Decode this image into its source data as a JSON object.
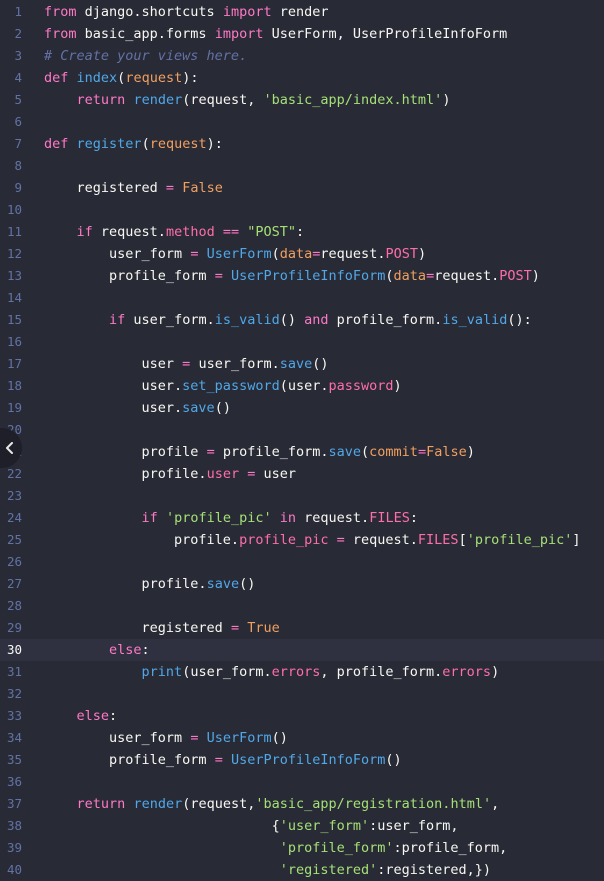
{
  "lines": [
    {
      "n": "1",
      "tokens": [
        [
          "kw",
          "from"
        ],
        [
          "plain",
          " django.shortcuts "
        ],
        [
          "kw",
          "import"
        ],
        [
          "plain",
          " render"
        ]
      ]
    },
    {
      "n": "2",
      "tokens": [
        [
          "kw",
          "from"
        ],
        [
          "plain",
          " basic_app.forms "
        ],
        [
          "kw",
          "import"
        ],
        [
          "plain",
          " UserForm, UserProfileInfoForm"
        ]
      ]
    },
    {
      "n": "3",
      "tokens": [
        [
          "cmt",
          "# Create your views here."
        ]
      ]
    },
    {
      "n": "4",
      "tokens": [
        [
          "kw",
          "def"
        ],
        [
          "plain",
          " "
        ],
        [
          "fn",
          "index"
        ],
        [
          "plain",
          "("
        ],
        [
          "param",
          "request"
        ],
        [
          "plain",
          "):"
        ]
      ]
    },
    {
      "n": "5",
      "tokens": [
        [
          "plain",
          "    "
        ],
        [
          "kw",
          "return"
        ],
        [
          "plain",
          " "
        ],
        [
          "fn",
          "render"
        ],
        [
          "plain",
          "(request, "
        ],
        [
          "str",
          "'basic_app/index.html'"
        ],
        [
          "plain",
          ")"
        ]
      ]
    },
    {
      "n": "6",
      "tokens": []
    },
    {
      "n": "7",
      "tokens": [
        [
          "kw",
          "def"
        ],
        [
          "plain",
          " "
        ],
        [
          "fn",
          "register"
        ],
        [
          "plain",
          "("
        ],
        [
          "param",
          "request"
        ],
        [
          "plain",
          "):"
        ]
      ]
    },
    {
      "n": "8",
      "tokens": []
    },
    {
      "n": "9",
      "tokens": [
        [
          "plain",
          "    registered "
        ],
        [
          "op",
          "="
        ],
        [
          "plain",
          " "
        ],
        [
          "num",
          "False"
        ]
      ]
    },
    {
      "n": "10",
      "tokens": []
    },
    {
      "n": "11",
      "tokens": [
        [
          "plain",
          "    "
        ],
        [
          "kw",
          "if"
        ],
        [
          "plain",
          " request."
        ],
        [
          "attr",
          "method"
        ],
        [
          "plain",
          " "
        ],
        [
          "op",
          "=="
        ],
        [
          "plain",
          " "
        ],
        [
          "str",
          "\"POST\""
        ],
        [
          "plain",
          ":"
        ]
      ]
    },
    {
      "n": "12",
      "tokens": [
        [
          "plain",
          "        user_form "
        ],
        [
          "op",
          "="
        ],
        [
          "plain",
          " "
        ],
        [
          "cls",
          "UserForm"
        ],
        [
          "plain",
          "("
        ],
        [
          "param",
          "data"
        ],
        [
          "op",
          "="
        ],
        [
          "plain",
          "request."
        ],
        [
          "attr",
          "POST"
        ],
        [
          "plain",
          ")"
        ]
      ]
    },
    {
      "n": "13",
      "tokens": [
        [
          "plain",
          "        profile_form "
        ],
        [
          "op",
          "="
        ],
        [
          "plain",
          " "
        ],
        [
          "cls",
          "UserProfileInfoForm"
        ],
        [
          "plain",
          "("
        ],
        [
          "param",
          "data"
        ],
        [
          "op",
          "="
        ],
        [
          "plain",
          "request."
        ],
        [
          "attr",
          "POST"
        ],
        [
          "plain",
          ")"
        ]
      ]
    },
    {
      "n": "14",
      "tokens": []
    },
    {
      "n": "15",
      "tokens": [
        [
          "plain",
          "        "
        ],
        [
          "kw",
          "if"
        ],
        [
          "plain",
          " user_form."
        ],
        [
          "fn",
          "is_valid"
        ],
        [
          "plain",
          "() "
        ],
        [
          "kw",
          "and"
        ],
        [
          "plain",
          " profile_form."
        ],
        [
          "fn",
          "is_valid"
        ],
        [
          "plain",
          "():"
        ]
      ]
    },
    {
      "n": "16",
      "tokens": []
    },
    {
      "n": "17",
      "tokens": [
        [
          "plain",
          "            user "
        ],
        [
          "op",
          "="
        ],
        [
          "plain",
          " user_form."
        ],
        [
          "fn",
          "save"
        ],
        [
          "plain",
          "()"
        ]
      ]
    },
    {
      "n": "18",
      "tokens": [
        [
          "plain",
          "            user."
        ],
        [
          "fn",
          "set_password"
        ],
        [
          "plain",
          "(user."
        ],
        [
          "attr",
          "password"
        ],
        [
          "plain",
          ")"
        ]
      ]
    },
    {
      "n": "19",
      "tokens": [
        [
          "plain",
          "            user."
        ],
        [
          "fn",
          "save"
        ],
        [
          "plain",
          "()"
        ]
      ]
    },
    {
      "n": "20",
      "tokens": []
    },
    {
      "n": "21",
      "tokens": [
        [
          "plain",
          "            profile "
        ],
        [
          "op",
          "="
        ],
        [
          "plain",
          " profile_form."
        ],
        [
          "fn",
          "save"
        ],
        [
          "plain",
          "("
        ],
        [
          "param",
          "commit"
        ],
        [
          "op",
          "="
        ],
        [
          "num",
          "False"
        ],
        [
          "plain",
          ")"
        ]
      ]
    },
    {
      "n": "22",
      "tokens": [
        [
          "plain",
          "            profile."
        ],
        [
          "attr",
          "user"
        ],
        [
          "plain",
          " "
        ],
        [
          "op",
          "="
        ],
        [
          "plain",
          " user"
        ]
      ]
    },
    {
      "n": "23",
      "tokens": []
    },
    {
      "n": "24",
      "tokens": [
        [
          "plain",
          "            "
        ],
        [
          "kw",
          "if"
        ],
        [
          "plain",
          " "
        ],
        [
          "str",
          "'profile_pic'"
        ],
        [
          "plain",
          " "
        ],
        [
          "kw",
          "in"
        ],
        [
          "plain",
          " request."
        ],
        [
          "attr",
          "FILES"
        ],
        [
          "plain",
          ":"
        ]
      ]
    },
    {
      "n": "25",
      "tokens": [
        [
          "plain",
          "                profile."
        ],
        [
          "attr",
          "profile_pic"
        ],
        [
          "plain",
          " "
        ],
        [
          "op",
          "="
        ],
        [
          "plain",
          " request."
        ],
        [
          "attr",
          "FILES"
        ],
        [
          "plain",
          "["
        ],
        [
          "str",
          "'profile_pic'"
        ],
        [
          "plain",
          "]"
        ]
      ]
    },
    {
      "n": "26",
      "tokens": []
    },
    {
      "n": "27",
      "tokens": [
        [
          "plain",
          "            profile."
        ],
        [
          "fn",
          "save"
        ],
        [
          "plain",
          "()"
        ]
      ]
    },
    {
      "n": "28",
      "tokens": []
    },
    {
      "n": "29",
      "tokens": [
        [
          "plain",
          "            registered "
        ],
        [
          "op",
          "="
        ],
        [
          "plain",
          " "
        ],
        [
          "num",
          "True"
        ]
      ]
    },
    {
      "n": "30",
      "tokens": [
        [
          "plain",
          "        "
        ],
        [
          "kw",
          "else"
        ],
        [
          "plain",
          ":"
        ]
      ],
      "active": true
    },
    {
      "n": "31",
      "tokens": [
        [
          "plain",
          "            "
        ],
        [
          "builtin",
          "print"
        ],
        [
          "plain",
          "(user_form."
        ],
        [
          "attr",
          "errors"
        ],
        [
          "plain",
          ", profile_form."
        ],
        [
          "attr",
          "errors"
        ],
        [
          "plain",
          ")"
        ]
      ]
    },
    {
      "n": "32",
      "tokens": []
    },
    {
      "n": "33",
      "tokens": [
        [
          "plain",
          "    "
        ],
        [
          "kw",
          "else"
        ],
        [
          "plain",
          ":"
        ]
      ]
    },
    {
      "n": "34",
      "tokens": [
        [
          "plain",
          "        user_form "
        ],
        [
          "op",
          "="
        ],
        [
          "plain",
          " "
        ],
        [
          "cls",
          "UserForm"
        ],
        [
          "plain",
          "()"
        ]
      ]
    },
    {
      "n": "35",
      "tokens": [
        [
          "plain",
          "        profile_form "
        ],
        [
          "op",
          "="
        ],
        [
          "plain",
          " "
        ],
        [
          "cls",
          "UserProfileInfoForm"
        ],
        [
          "plain",
          "()"
        ]
      ]
    },
    {
      "n": "36",
      "tokens": []
    },
    {
      "n": "37",
      "tokens": [
        [
          "plain",
          "    "
        ],
        [
          "kw",
          "return"
        ],
        [
          "plain",
          " "
        ],
        [
          "fn",
          "render"
        ],
        [
          "plain",
          "(request,"
        ],
        [
          "str",
          "'basic_app/registration.html'"
        ],
        [
          "plain",
          ","
        ]
      ]
    },
    {
      "n": "38",
      "tokens": [
        [
          "plain",
          "                            {"
        ],
        [
          "str",
          "'user_form'"
        ],
        [
          "plain",
          ":user_form,"
        ]
      ]
    },
    {
      "n": "39",
      "tokens": [
        [
          "plain",
          "                             "
        ],
        [
          "str",
          "'profile_form'"
        ],
        [
          "plain",
          ":profile_form,"
        ]
      ]
    },
    {
      "n": "40",
      "tokens": [
        [
          "plain",
          "                             "
        ],
        [
          "str",
          "'registered'"
        ],
        [
          "plain",
          ":registered,})"
        ]
      ]
    }
  ],
  "collapse_icon": "chevron-left-icon",
  "colors": {
    "background": "#282a36",
    "active_line": "#2f3140",
    "line_number": "#6272a4",
    "keyword": "#ff79c6",
    "function": "#50a8e8",
    "string": "#a5e075",
    "number": "#f1a05f"
  }
}
